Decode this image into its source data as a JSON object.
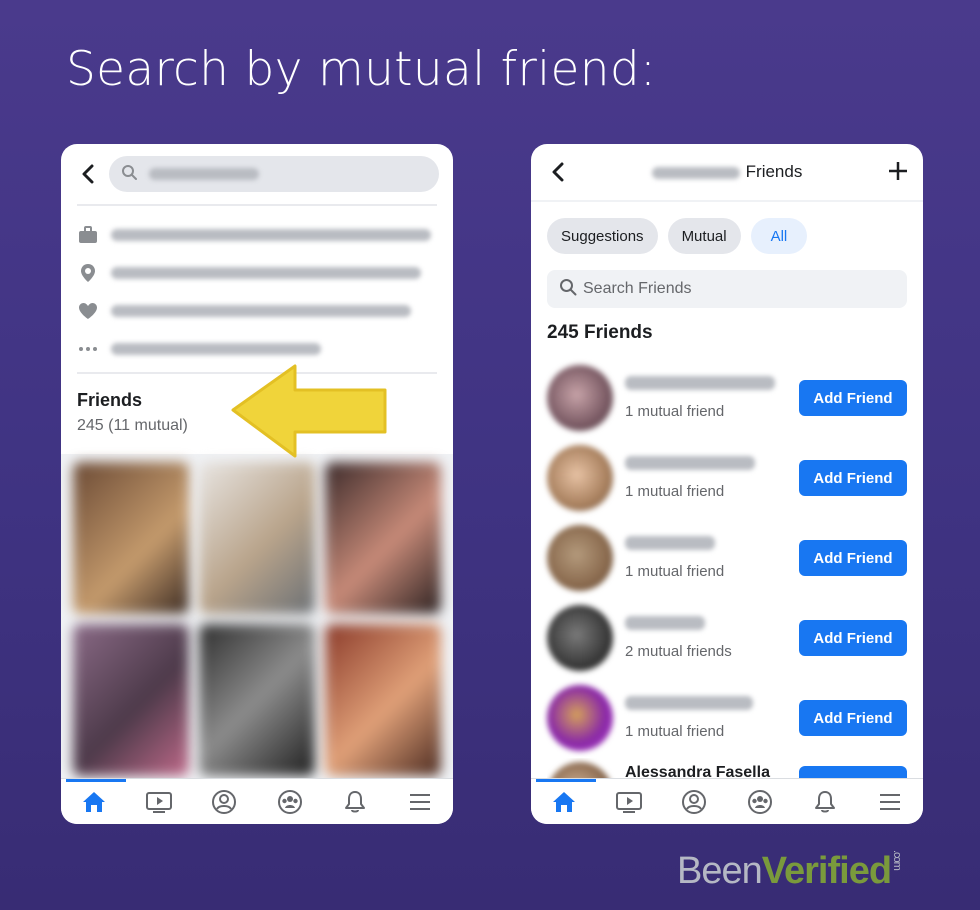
{
  "headline": "Search by mutual friend:",
  "left_phone": {
    "friends_title": "Friends",
    "friends_count": "245 (11 mutual)",
    "arrow_color": "#f0d43a"
  },
  "right_phone": {
    "header_title": "Friends",
    "chips": [
      "Suggestions",
      "Mutual",
      "All"
    ],
    "active_chip": "All",
    "search_placeholder": "Search Friends",
    "friends_count": "245 Friends",
    "friends": [
      {
        "mutual": "1 mutual friend",
        "button": "Add Friend"
      },
      {
        "mutual": "1 mutual friend",
        "button": "Add Friend"
      },
      {
        "mutual": "1 mutual friend",
        "button": "Add Friend"
      },
      {
        "mutual": "2 mutual friends",
        "button": "Add Friend"
      },
      {
        "mutual": "1 mutual friend",
        "button": "Add Friend"
      }
    ],
    "partial_friend_name": "Alessandra Fasella"
  },
  "tabbar_icons": [
    "home-icon",
    "video-icon",
    "profile-icon",
    "groups-icon",
    "bell-icon",
    "menu-icon"
  ],
  "logo": {
    "been": "Been",
    "verified": "Verified",
    "dotcom": ".com"
  },
  "colors": {
    "accent": "#1877f2",
    "background": "#41358a",
    "logo_green": "#7a9a3c"
  }
}
